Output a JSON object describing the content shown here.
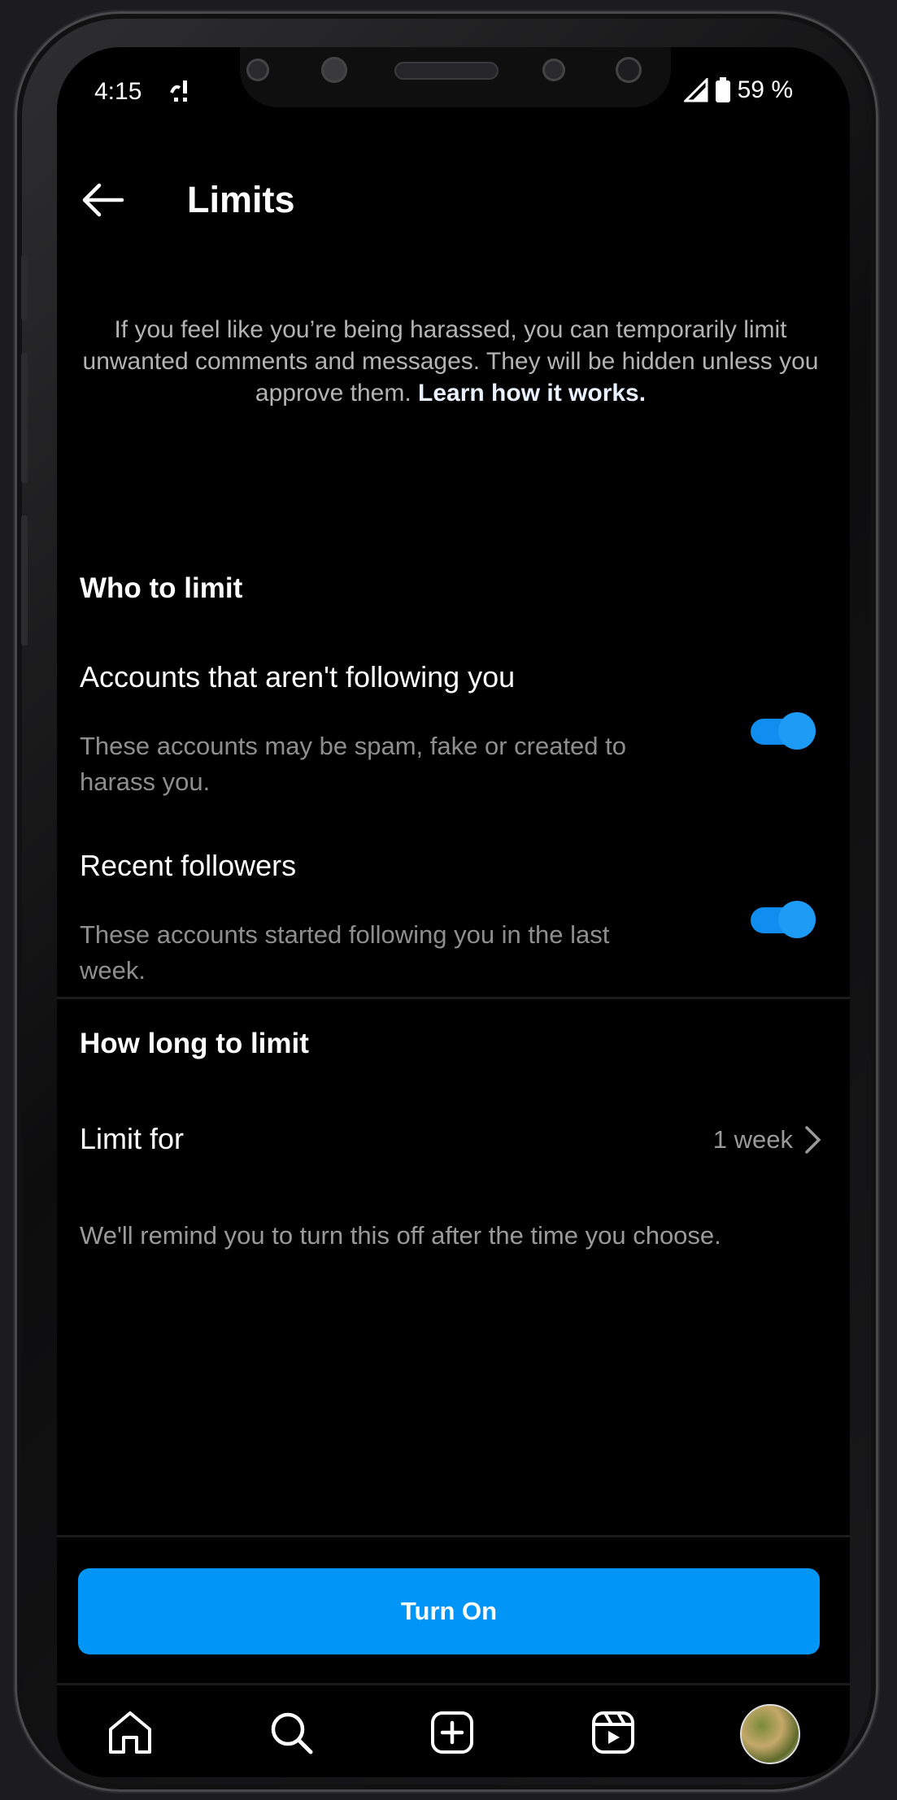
{
  "status_bar": {
    "time": "4:15",
    "battery": "59 %"
  },
  "header": {
    "title": "Limits"
  },
  "intro": {
    "text": "If you feel like you’re being harassed, you can temporarily limit unwanted comments and messages. They will be hidden unless you approve them.",
    "link": "Learn how it works."
  },
  "who_section": {
    "label": "Who to limit",
    "options": [
      {
        "title": "Accounts that aren't following you",
        "description": "These accounts may be spam, fake or created to harass you.",
        "enabled": true
      },
      {
        "title": "Recent followers",
        "description": "These accounts started following you in the last week.",
        "enabled": true
      }
    ]
  },
  "how_long_section": {
    "label": "How long to limit",
    "limit_for_label": "Limit for",
    "limit_for_value": "1 week",
    "reminder": "We'll remind you to turn this off after the time you choose."
  },
  "action": {
    "turn_on_label": "Turn On"
  },
  "bottom_nav": [
    "home-icon",
    "search-icon",
    "create-icon",
    "reels-icon",
    "profile-avatar"
  ],
  "colors": {
    "accent": "#0095f6",
    "background": "#000000",
    "secondary_text": "#8e8e8e"
  }
}
